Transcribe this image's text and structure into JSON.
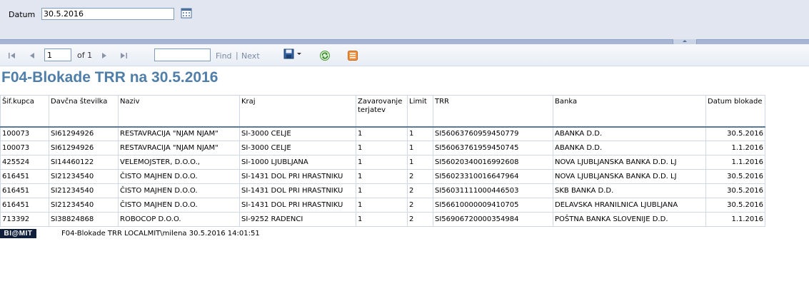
{
  "params": {
    "date_label": "Datum",
    "date_value": "30.5.2016"
  },
  "icons": {
    "calendar": "calendar-icon",
    "first_page": "first-page-icon",
    "prev_page": "prev-page-icon",
    "next_page": "next-page-icon",
    "last_page": "last-page-icon",
    "export": "save-export-icon",
    "refresh": "refresh-icon",
    "print": "print-icon"
  },
  "toolbar": {
    "page_value": "1",
    "of_label": "of 1",
    "find_placeholder": "",
    "find_label": "Find",
    "separator": "|",
    "next_label": "Next"
  },
  "report": {
    "title": "F04-Blokade TRR na 30.5.2016",
    "columns": [
      "Šif.kupca",
      "Davčna številka",
      "Naziv",
      "Kraj",
      "Zavarovanje terjatev",
      "Limit",
      "TRR",
      "Banka",
      "Datum blokade"
    ],
    "rows": [
      [
        "100073",
        "SI61294926",
        "RESTAVRACIJA \"NJAM NJAM\"",
        "SI-3000 CELJE",
        "1",
        "1",
        "SI56063760959450779",
        "ABANKA D.D.",
        "30.5.2016"
      ],
      [
        "100073",
        "SI61294926",
        "RESTAVRACIJA \"NJAM NJAM\"",
        "SI-3000 CELJE",
        "1",
        "1",
        "SI56063761959450745",
        "ABANKA D.D.",
        "1.1.2016"
      ],
      [
        "425524",
        "SI14460122",
        "VELEMOJSTER, D.O.O.,",
        "SI-1000 LJUBLJANA",
        "1",
        "1",
        "SI56020340016992608",
        "NOVA LJUBLJANSKA BANKA D.D. LJ",
        "1.1.2016"
      ],
      [
        "616451",
        "SI21234540",
        "ČISTO MAJHEN D.O.O.",
        "SI-1431 DOL PRI HRASTNIKU",
        "1",
        "2",
        "SI56023310016647964",
        "NOVA LJUBLJANSKA BANKA D.D. LJ",
        "30.5.2016"
      ],
      [
        "616451",
        "SI21234540",
        "ČISTO MAJHEN D.O.O.",
        "SI-1431 DOL PRI HRASTNIKU",
        "1",
        "2",
        "SI56031111000446503",
        "SKB BANKA D.D.",
        "30.5.2016"
      ],
      [
        "616451",
        "SI21234540",
        "ČISTO MAJHEN D.O.O.",
        "SI-1431 DOL PRI HRASTNIKU",
        "1",
        "2",
        "SI56610000009410705",
        "DELAVSKA HRANILNICA LJUBLJANA",
        "30.5.2016"
      ],
      [
        "713392",
        "SI38824868",
        "ROBOCOP D.O.O.",
        "SI-9252 RADENCI",
        "1",
        "2",
        "SI56906720000354984",
        "POŠTNA BANKA SLOVENIJE D.D.",
        "1.1.2016"
      ]
    ],
    "footer_logo": "BI@MIT",
    "footer_text": "F04-Blokade TRR LOCALMIT\\milena 30.5.2016 14:01:51"
  }
}
